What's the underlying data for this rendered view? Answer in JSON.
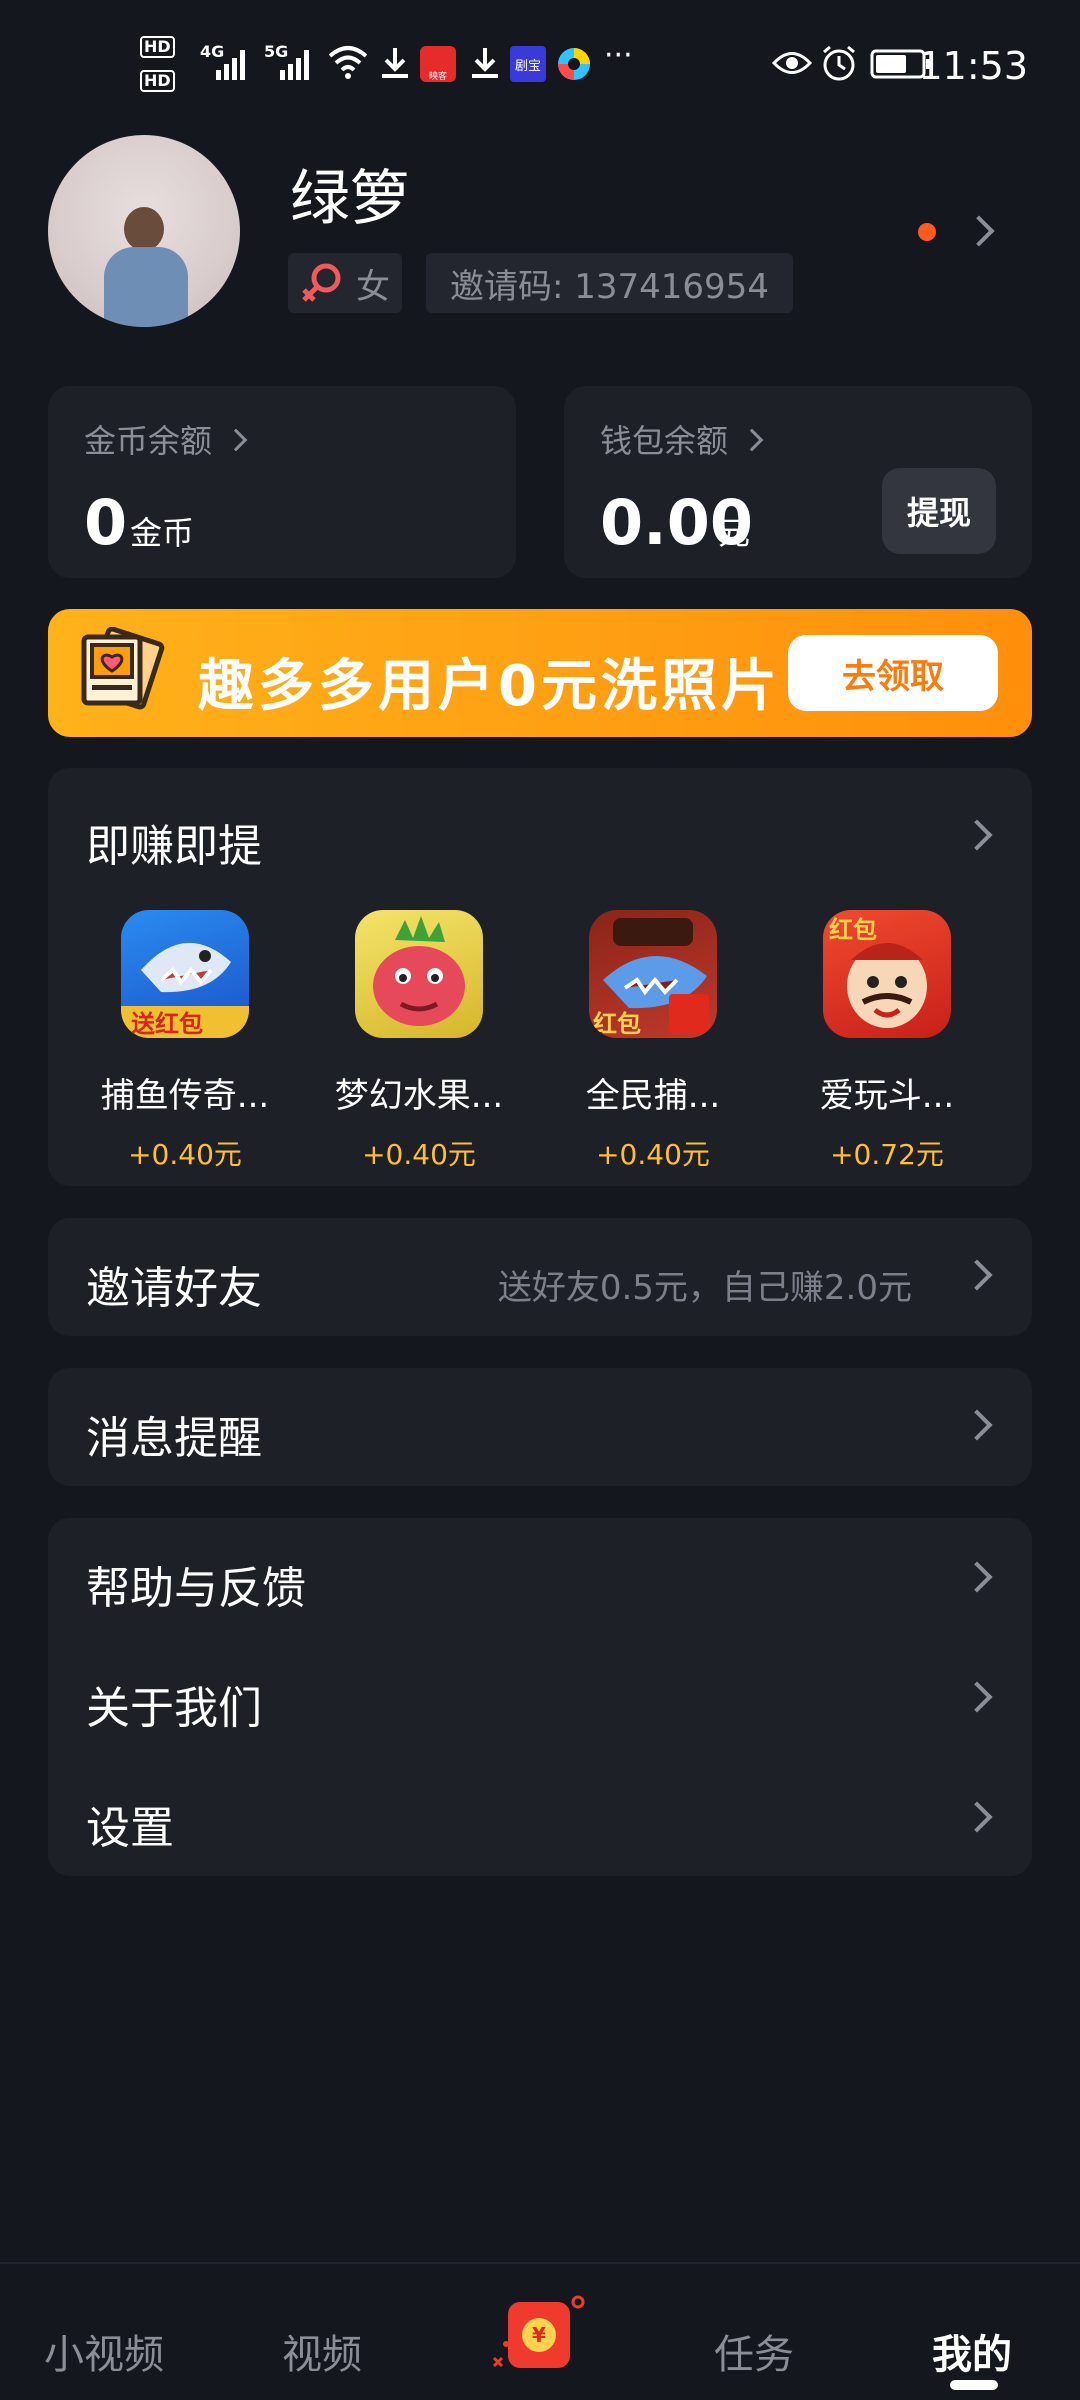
{
  "status_bar": {
    "network_1": "4G",
    "network_2": "5G",
    "hd1": "HD",
    "hd2": "HD",
    "app_badge_1": "映客",
    "app_badge_2": "剧宝",
    "more": "···",
    "time": "11:53"
  },
  "profile": {
    "username": "绿箩",
    "gender": "女",
    "invite_code": "邀请码: 137416954"
  },
  "balances": {
    "coin_title": "金币余额",
    "coin_value": "0",
    "coin_unit": "金币",
    "wallet_title": "钱包余额",
    "wallet_value": "0.00",
    "wallet_unit": "元",
    "withdraw_label": "提现"
  },
  "banner": {
    "text": "趣多多用户0元洗照片",
    "button": "去领取"
  },
  "earn": {
    "title": "即赚即提",
    "apps": [
      {
        "name": "捕鱼传奇...",
        "reward": "+0.40元",
        "badge": "送红包"
      },
      {
        "name": "梦幻水果...",
        "reward": "+0.40元",
        "badge": ""
      },
      {
        "name": "全民捕...",
        "reward": "+0.40元",
        "badge": "红包"
      },
      {
        "name": "爱玩斗...",
        "reward": "+0.72元",
        "badge": "红包"
      }
    ]
  },
  "menu": {
    "invite": "邀请好友",
    "invite_sub": "送好友0.5元，自己赚2.0元",
    "messages": "消息提醒",
    "help": "帮助与反馈",
    "about": "关于我们",
    "settings": "设置"
  },
  "nav": {
    "short_video": "小视频",
    "video": "视频",
    "task": "任务",
    "mine": "我的",
    "redpacket_symbol": "¥"
  },
  "colors": {
    "background": "#15171e",
    "card": "#1e2028",
    "accent_orange": "#ff9d12",
    "reward_yellow": "#ffbf2e",
    "dot_red": "#ff5a1f"
  }
}
